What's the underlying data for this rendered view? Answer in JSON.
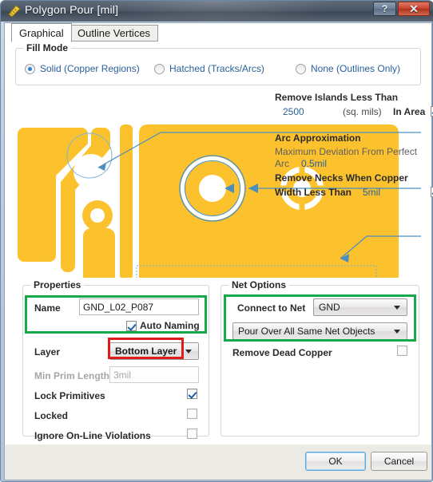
{
  "window": {
    "title": "Polygon Pour [mil]",
    "icon": "polygon-pour-icon",
    "help_label": "?",
    "close_label": "✕"
  },
  "tabs": [
    {
      "label": "Graphical",
      "active": true
    },
    {
      "label": "Outline Vertices",
      "active": false
    }
  ],
  "fill_mode": {
    "title": "Fill Mode",
    "options": [
      {
        "label": "Solid (Copper Regions)",
        "selected": true
      },
      {
        "label": "Hatched (Tracks/Arcs)",
        "selected": false
      },
      {
        "label": "None (Outlines Only)",
        "selected": false
      }
    ]
  },
  "annotations": {
    "remove_islands": {
      "title": "Remove Islands Less Than",
      "value": "2500",
      "unit": "(sq. mils)",
      "suffix": "In Area",
      "checked": true
    },
    "arc_approximation": {
      "title": "Arc Approximation",
      "description": "Maximum Deviation From Perfect",
      "label": "Arc",
      "value": "0.5mil"
    },
    "remove_necks": {
      "title": "Remove Necks When Copper",
      "label": "Width Less Than",
      "value": "5mil",
      "checked": true
    }
  },
  "properties": {
    "title": "Properties",
    "name_label": "Name",
    "name_value": "GND_L02_P087",
    "auto_naming_label": "Auto Naming",
    "auto_naming_checked": true,
    "layer_label": "Layer",
    "layer_value": "Bottom Layer",
    "min_prim_label": "Min Prim Length",
    "min_prim_value": "3mil",
    "lock_primitives_label": "Lock Primitives",
    "lock_primitives_checked": true,
    "locked_label": "Locked",
    "locked_checked": false,
    "ignore_online_label": "Ignore On-Line Violations",
    "ignore_online_checked": false
  },
  "net_options": {
    "title": "Net Options",
    "connect_label": "Connect to Net",
    "connect_value": "GND",
    "pour_value": "Pour Over All Same Net Objects",
    "remove_dead_copper_label": "Remove Dead Copper",
    "remove_dead_copper_checked": false
  },
  "footer": {
    "ok_label": "OK",
    "cancel_label": "Cancel"
  },
  "colors": {
    "copper": "#FCC22D",
    "annotation_line": "#4a8fc0",
    "link_text": "#2a6099",
    "highlight_green": "#15a94a",
    "highlight_red": "#e01b1b",
    "titlebar": "#4a5666"
  }
}
